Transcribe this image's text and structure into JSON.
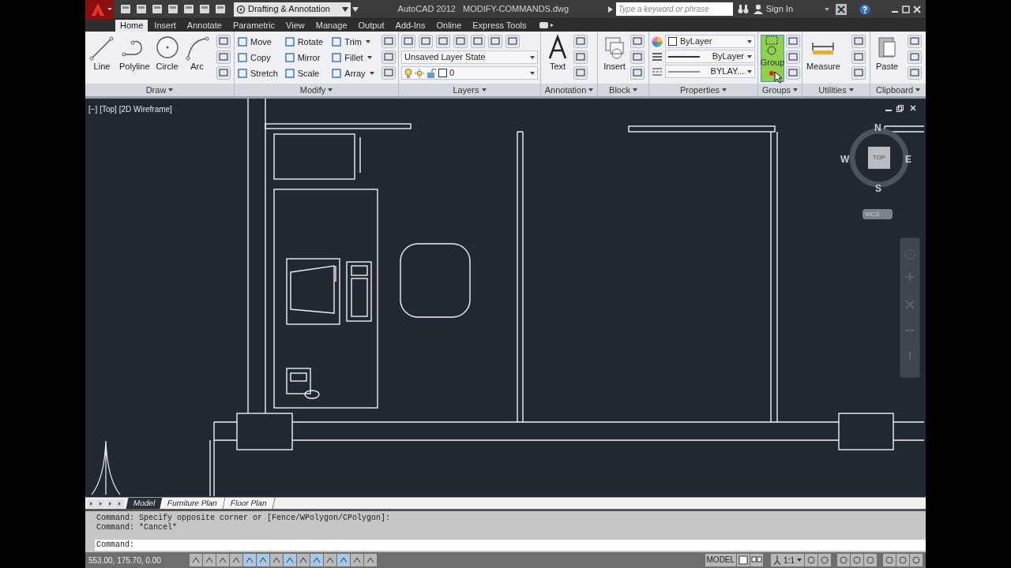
{
  "workspace": "Drafting & Annotation",
  "title": "AutoCAD 2012   MODIFY-COMMANDS.dwg",
  "search": {
    "placeholder": "Type a keyword or phrase"
  },
  "sign_in": "Sign In",
  "tabs": [
    {
      "label": "Home",
      "selected": true
    },
    {
      "label": "Insert",
      "selected": false
    },
    {
      "label": "Annotate",
      "selected": false
    },
    {
      "label": "Parametric",
      "selected": false
    },
    {
      "label": "View",
      "selected": false
    },
    {
      "label": "Manage",
      "selected": false
    },
    {
      "label": "Output",
      "selected": false
    },
    {
      "label": "Add-Ins",
      "selected": false
    },
    {
      "label": "Online",
      "selected": false
    },
    {
      "label": "Express Tools",
      "selected": false
    }
  ],
  "ribbon": {
    "draw": {
      "title": "Draw",
      "tools": [
        "Line",
        "Polyline",
        "Circle",
        "Arc"
      ]
    },
    "modify": {
      "title": "Modify",
      "tools": [
        "Move",
        "Copy",
        "Stretch",
        "Rotate",
        "Mirror",
        "Scale",
        "Trim",
        "Fillet",
        "Array"
      ]
    },
    "layers": {
      "title": "Layers",
      "layer_state": "Unsaved Layer State",
      "current_layer": "0"
    },
    "annotation": {
      "title": "Annotation",
      "tool": "Text"
    },
    "block": {
      "title": "Block",
      "tool": "Insert"
    },
    "properties": {
      "title": "Properties",
      "color_setting": "ByLayer",
      "lineweight": "ByLayer",
      "linetype": "BYLAY..."
    },
    "groups": {
      "title": "Groups",
      "tool": "Group"
    },
    "utilities": {
      "title": "Utilities",
      "tool": "Measure"
    },
    "clipboard": {
      "title": "Clipboard",
      "tool": "Paste"
    }
  },
  "viewport": {
    "label": "[−] [Top] [2D Wireframe]",
    "viewcube": {
      "face": "TOP",
      "north": "N",
      "east": "E",
      "south": "S",
      "west": "W"
    },
    "ucs": "WCS"
  },
  "layout_tabs": [
    {
      "label": "Model",
      "selected": true
    },
    {
      "label": "Furniture Plan",
      "selected": false
    },
    {
      "label": "Floor Plan",
      "selected": false
    }
  ],
  "command": {
    "history": [
      "Command: Specify opposite corner or [Fence/WPolygon/CPolygon]:",
      "Command: *Cancel*"
    ],
    "prompt": "Command:"
  },
  "status": {
    "coords": "553.00, 175.70, 0.00",
    "space": "MODEL",
    "scale": "1:1"
  }
}
